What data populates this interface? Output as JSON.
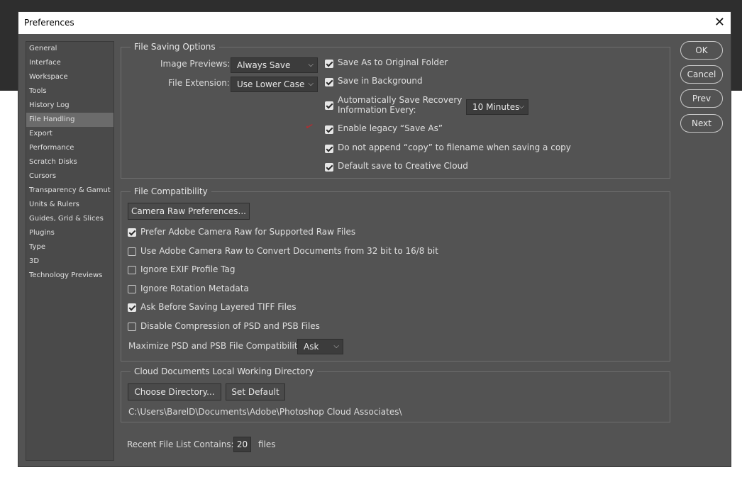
{
  "window": {
    "title": "Preferences",
    "close_glyph": "✕"
  },
  "sidebar": {
    "items": [
      {
        "label": "General",
        "active": false
      },
      {
        "label": "Interface",
        "active": false
      },
      {
        "label": "Workspace",
        "active": false
      },
      {
        "label": "Tools",
        "active": false
      },
      {
        "label": "History Log",
        "active": false
      },
      {
        "label": "File Handling",
        "active": true
      },
      {
        "label": "Export",
        "active": false
      },
      {
        "label": "Performance",
        "active": false
      },
      {
        "label": "Scratch Disks",
        "active": false
      },
      {
        "label": "Cursors",
        "active": false
      },
      {
        "label": "Transparency & Gamut",
        "active": false
      },
      {
        "label": "Units & Rulers",
        "active": false
      },
      {
        "label": "Guides, Grid & Slices",
        "active": false
      },
      {
        "label": "Plugins",
        "active": false
      },
      {
        "label": "Type",
        "active": false
      },
      {
        "label": "3D",
        "active": false
      },
      {
        "label": "Technology Previews",
        "active": false
      }
    ]
  },
  "file_saving": {
    "title": "File Saving Options",
    "image_previews": {
      "label": "Image Previews:",
      "value": "Always Save"
    },
    "file_extension": {
      "label": "File Extension:",
      "value": "Use Lower Case"
    },
    "save_as_original": {
      "label": "Save As to Original Folder",
      "checked": true
    },
    "save_background": {
      "label": "Save in Background",
      "checked": true
    },
    "auto_recovery": {
      "label_line1": "Automatically Save Recovery",
      "label_line2": "Information Every:",
      "checked": true,
      "value": "10 Minutes"
    },
    "legacy_save_as": {
      "label": "Enable legacy “Save As”",
      "checked": true
    },
    "no_copy_append": {
      "label": "Do not append “copy” to filename when saving a copy",
      "checked": true
    },
    "default_creative_cloud": {
      "label": "Default save to Creative Cloud",
      "checked": true
    }
  },
  "file_compat": {
    "title": "File Compatibility",
    "camera_raw_button": "Camera Raw Preferences...",
    "prefer_acr": {
      "label": "Prefer Adobe Camera Raw for Supported Raw Files",
      "checked": true
    },
    "use_acr_convert": {
      "label": "Use Adobe Camera Raw to Convert Documents from 32 bit to 16/8 bit",
      "checked": false
    },
    "ignore_exif": {
      "label": "Ignore EXIF Profile Tag",
      "checked": false
    },
    "ignore_rotation": {
      "label": "Ignore Rotation Metadata",
      "checked": false
    },
    "ask_tiff": {
      "label": "Ask Before Saving Layered TIFF Files",
      "checked": true
    },
    "disable_compression": {
      "label": "Disable Compression of PSD and PSB Files",
      "checked": false
    },
    "maximize": {
      "label": "Maximize PSD and PSB File Compatibility:",
      "value": "Ask"
    }
  },
  "cloud_docs": {
    "title": "Cloud Documents Local Working Directory",
    "choose_button": "Choose Directory...",
    "default_button": "Set Default",
    "path": "C:\\Users\\BarelD\\Documents\\Adobe\\Photoshop Cloud Associates\\"
  },
  "recent_files": {
    "label": "Recent File List Contains:",
    "value": "20",
    "unit": "files"
  },
  "actions": {
    "ok": "OK",
    "cancel": "Cancel",
    "prev": "Prev",
    "next": "Next"
  },
  "annotation": {
    "mark": "✓"
  },
  "colors": {
    "dialog_bg": "#535353",
    "sidebar_bg": "#4a4a4a",
    "active_item": "#6b6b6b",
    "annotation": "#c0282c"
  }
}
